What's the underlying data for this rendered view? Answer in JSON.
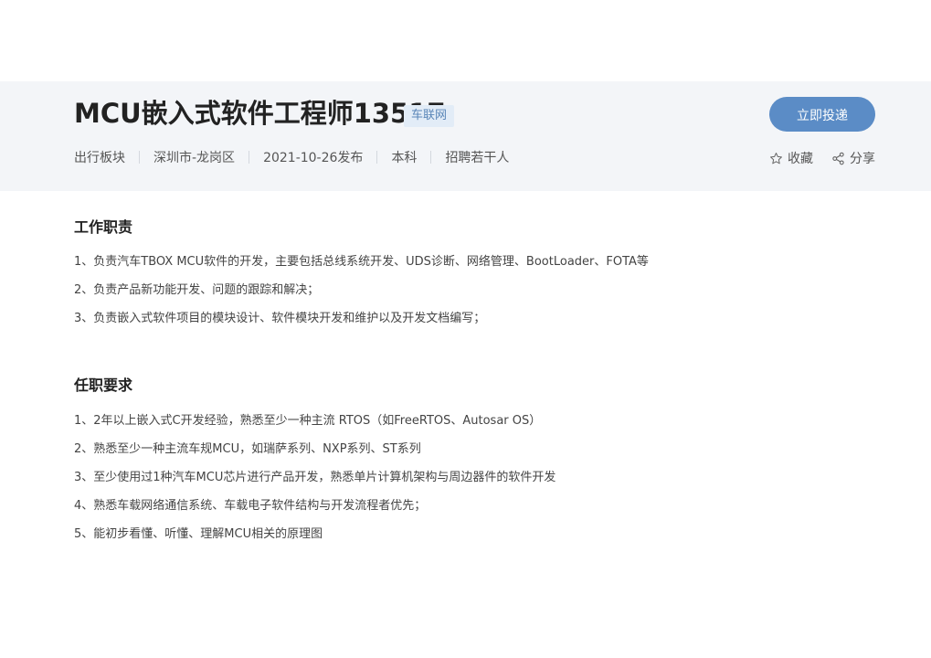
{
  "job": {
    "title": "MCU嵌入式软件工程师13517",
    "tag": "车联网",
    "apply_label": "立即投递",
    "meta": [
      "出行板块",
      "深圳市-龙岗区",
      "2021-10-26发布",
      "本科",
      "招聘若干人"
    ],
    "favorite_label": "收藏",
    "share_label": "分享"
  },
  "duties": {
    "heading": "工作职责",
    "items": [
      "1、负责汽车TBOX MCU软件的开发，主要包括总线系统开发、UDS诊断、网络管理、BootLoader、FOTA等",
      "2、负责产品新功能开发、问题的跟踪和解决；",
      "3、负责嵌入式软件项目的模块设计、软件模块开发和维护以及开发文档编写；"
    ]
  },
  "requirements": {
    "heading": "任职要求",
    "items": [
      "1、2年以上嵌入式C开发经验，熟悉至少一种主流 RTOS（如FreeRTOS、Autosar OS）",
      "2、熟悉至少一种主流车规MCU，如瑞萨系列、NXP系列、ST系列",
      "3、至少使用过1种汽车MCU芯片进行产品开发，熟悉单片计算机架构与周边器件的软件开发",
      "4、熟悉车载网络通信系统、车载电子软件结构与开发流程者优先；",
      "5、能初步看懂、听懂、理解MCU相关的原理图"
    ]
  },
  "icons": {
    "favorite": "star-icon",
    "share": "share-icon"
  },
  "colors": {
    "header_bg": "#f3f5f8",
    "accent": "#5b8cc6",
    "tag_bg": "#e2ecf7",
    "tag_text": "#5a86b8"
  }
}
